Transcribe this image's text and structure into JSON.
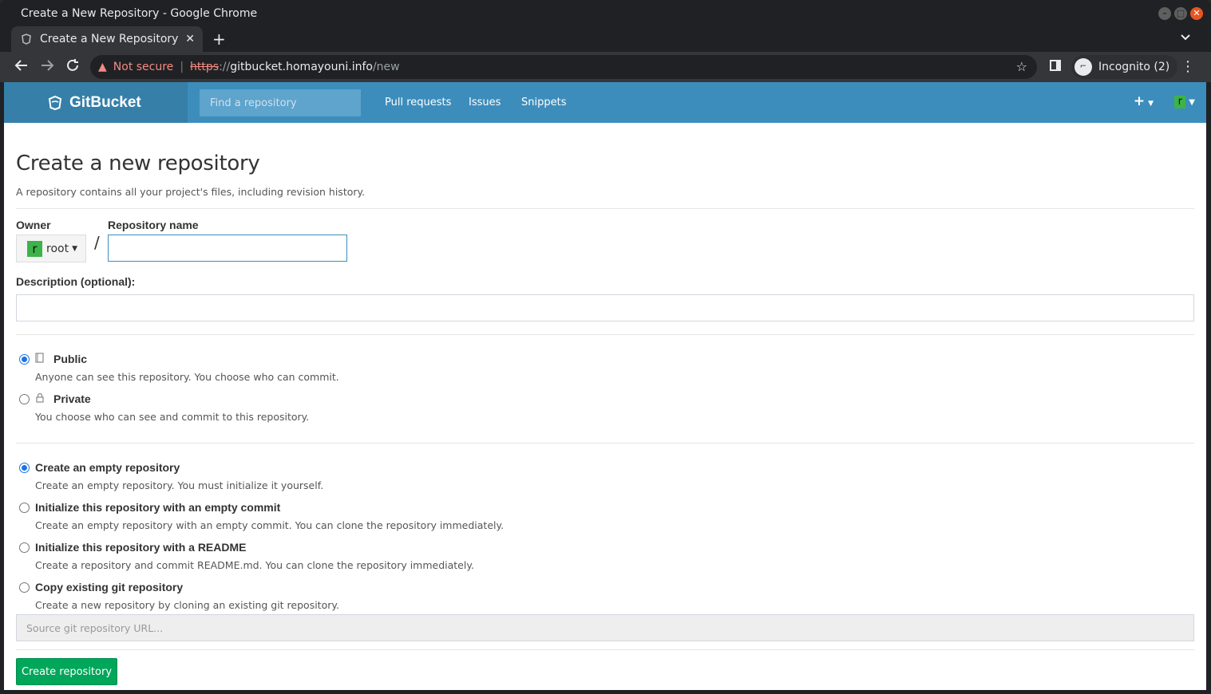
{
  "window": {
    "title": "Create a New Repository - Google Chrome",
    "controls": [
      "–",
      "□",
      "✕"
    ]
  },
  "tab": {
    "title": "Create a New Repository",
    "close": "✕"
  },
  "browser": {
    "not_secure": "Not secure",
    "url_scheme": "https",
    "url_sep": "://",
    "url_host": "gitbucket.homayouni.info",
    "url_path": "/new",
    "incognito": "Incognito (2)"
  },
  "nav": {
    "brand": "GitBucket",
    "search_placeholder": "Find a repository",
    "links": [
      "Pull requests",
      "Issues",
      "Snippets"
    ],
    "plus": "+",
    "user_initial": "r"
  },
  "page": {
    "title": "Create a new repository",
    "subtitle": "A repository contains all your project's files, including revision history.",
    "owner_label": "Owner",
    "owner_initial": "r",
    "owner_name": "root",
    "slash": "/",
    "repo_name_label": "Repository name",
    "repo_name_value": "",
    "description_label": "Description (optional):",
    "description_value": ""
  },
  "visibility": [
    {
      "title": "Public",
      "desc": "Anyone can see this repository. You choose who can commit.",
      "checked": true,
      "icon": "book-icon"
    },
    {
      "title": "Private",
      "desc": "You choose who can see and commit to this repository.",
      "checked": false,
      "icon": "lock-icon"
    }
  ],
  "init_options": [
    {
      "title": "Create an empty repository",
      "desc": "Create an empty repository. You must initialize it yourself.",
      "checked": true
    },
    {
      "title": "Initialize this repository with an empty commit",
      "desc": "Create an empty repository with an empty commit. You can clone the repository immediately.",
      "checked": false
    },
    {
      "title": "Initialize this repository with a README",
      "desc": "Create a repository and commit README.md. You can clone the repository immediately.",
      "checked": false
    },
    {
      "title": "Copy existing git repository",
      "desc": "Create a new repository by cloning an existing git repository.",
      "checked": false
    }
  ],
  "source_placeholder": "Source git repository URL...",
  "submit_label": "Create repository",
  "colors": {
    "navbar": "#3c8dbc",
    "brand": "#367fa9",
    "submit": "#00a65a",
    "avatar": "#3cb34a"
  }
}
